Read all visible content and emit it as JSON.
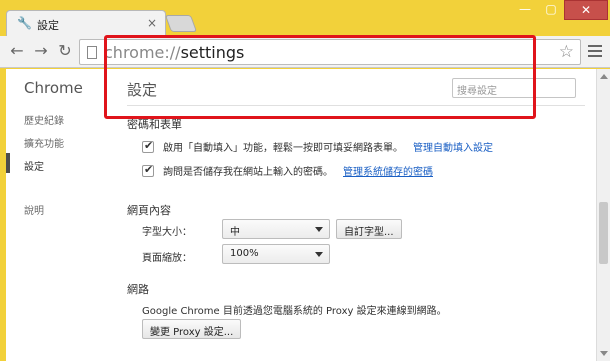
{
  "window": {
    "tab_title": "設定",
    "tab_close": "×",
    "minimize": "—",
    "maximize": "▢",
    "close": "✕"
  },
  "toolbar": {
    "back": "←",
    "forward": "→",
    "reload": "↻",
    "url_scheme": "chrome://",
    "url_path": "settings",
    "star": "☆"
  },
  "sidebar": {
    "brand": "Chrome",
    "items": [
      {
        "label": "歷史紀錄"
      },
      {
        "label": "擴充功能"
      },
      {
        "label": "設定"
      },
      {
        "label": "說明"
      }
    ]
  },
  "main": {
    "title": "設定",
    "search_placeholder": "搜尋設定",
    "passwords": {
      "heading": "密碼和表單",
      "autofill_text": "啟用「自動填入」功能，輕鬆一按即可填妥網路表單。",
      "autofill_link": "管理自動填入設定",
      "save_passwords_text": "詢問是否儲存我在網站上輸入的密碼。",
      "save_passwords_link": "管理系統儲存的密碼"
    },
    "web_content": {
      "heading": "網頁內容",
      "font_size_label": "字型大小：",
      "font_size_value": "中",
      "customize_fonts": "自訂字型...",
      "zoom_label": "頁面縮放：",
      "zoom_value": "100%"
    },
    "network": {
      "heading": "網路",
      "proxy_text": "Google Chrome 目前透過您電腦系統的 Proxy 設定來連線到網路。",
      "proxy_button": "變更 Proxy 設定..."
    }
  },
  "colors": {
    "frame": "#f2d13a",
    "highlight": "#e0141b",
    "link": "#1a5fc4"
  }
}
